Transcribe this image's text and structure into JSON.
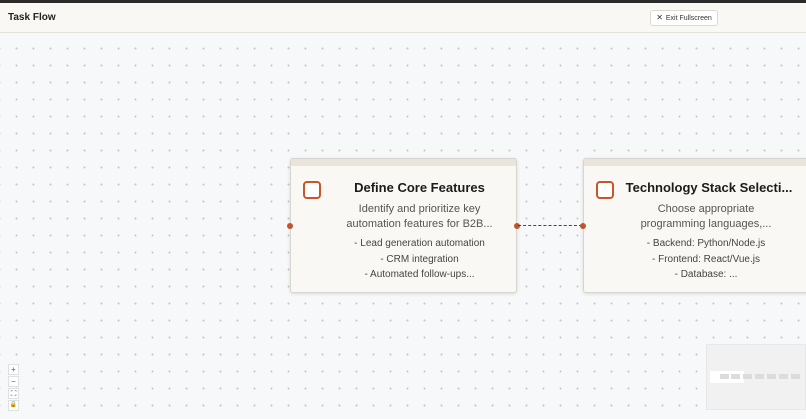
{
  "header": {
    "title": "Task Flow",
    "exit_label": "Exit Fullscreen",
    "exit_icon": "close-icon"
  },
  "nodes": [
    {
      "title": "Define Core Features",
      "description": [
        "Identify and prioritize key",
        "automation features for B2B..."
      ],
      "bullets": [
        "- Lead generation automation",
        "- CRM integration",
        "- Automated follow-ups..."
      ]
    },
    {
      "title": "Technology Stack Selecti...",
      "description": [
        "Choose appropriate",
        "programming languages,..."
      ],
      "bullets": [
        "- Backend: Python/Node.js",
        "- Frontend: React/Vue.js",
        "- Database: ..."
      ]
    }
  ],
  "controls": {
    "zoom_in": "+",
    "zoom_out": "−",
    "fit_view": "⛶",
    "lock": "🔒"
  },
  "colors": {
    "accent": "#c0542b",
    "node_bg": "#faf8f5",
    "node_strip": "#ebe4da",
    "edge": "#444444"
  }
}
